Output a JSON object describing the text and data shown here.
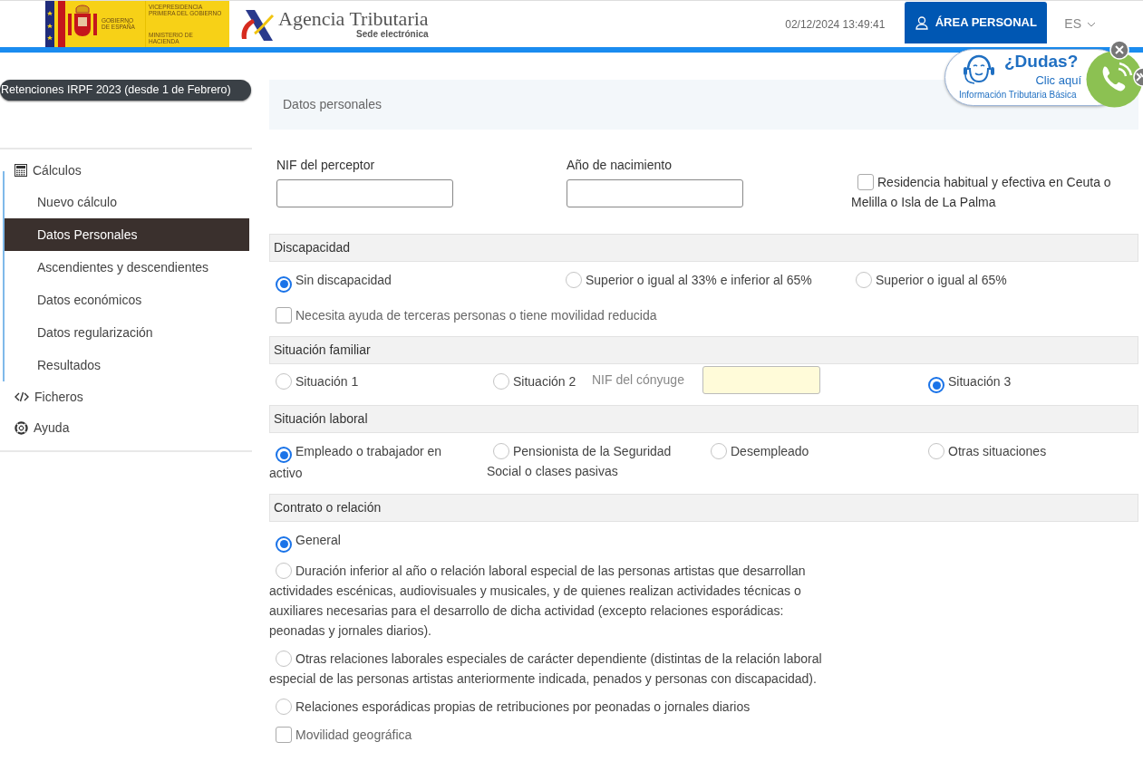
{
  "header": {
    "gov_top": "VICEPRESIDENCIA PRIMERA DEL GOBIERNO",
    "gov_left": "GOBIERNO DE ESPAÑA",
    "gov_bottom": "MINISTERIO DE HACIENDA",
    "agency": "Agencia Tributaria",
    "agency_sub": "Sede electrónica",
    "datetime": "02/12/2024 13:49:41",
    "area_button": "ÁREA PERSONAL",
    "language": "ES"
  },
  "help_widget": {
    "title": "¿Dudas?",
    "link": "Clic aquí",
    "subtitle": "Información Tributaria Básica"
  },
  "sidebar": {
    "title": "Retenciones IRPF 2023 (desde 1 de Febrero)",
    "items": [
      {
        "label": "Cálculos",
        "children": [
          {
            "label": "Nuevo cálculo",
            "selected": false
          },
          {
            "label": "Datos Personales",
            "selected": true
          },
          {
            "label": "Ascendientes y descendientes",
            "selected": false
          },
          {
            "label": "Datos económicos",
            "selected": false
          },
          {
            "label": "Datos regularización",
            "selected": false
          },
          {
            "label": "Resultados",
            "selected": false
          }
        ]
      },
      {
        "label": "Ficheros"
      },
      {
        "label": "Ayuda"
      }
    ]
  },
  "panel_title": "Datos personales",
  "top_fields": [
    {
      "label": "NIF del perceptor"
    },
    {
      "label": "Año de nacimiento"
    }
  ],
  "residence_checkbox": {
    "label": "Residencia habitual y efectiva en Ceuta o Melilla o Isla de La Palma",
    "checked": false
  },
  "sections": [
    {
      "title": "Discapacidad",
      "rows": [
        [
          {
            "kind": "radio",
            "label": "Sin discapacidad",
            "selected": true
          },
          {
            "kind": "radio",
            "label": "Superior o igual al 33% e inferior al 65%",
            "selected": false
          },
          {
            "kind": "radio",
            "label": "Superior o igual al 65%",
            "selected": false
          }
        ],
        [
          {
            "kind": "checkbox",
            "label": "Necesita ayuda de terceras personas o tiene movilidad reducida",
            "checked": false
          }
        ]
      ]
    },
    {
      "title": "Situación familiar",
      "rows": [
        [
          {
            "kind": "radio",
            "label": "Situación 1",
            "selected": false
          },
          {
            "kind": "radio",
            "label": "Situación 2",
            "selected": false
          },
          {
            "kind": "field",
            "label": "NIF del cónyuge"
          },
          {
            "kind": "radio",
            "label": "Situación 3",
            "selected": true
          }
        ]
      ]
    },
    {
      "title": "Situación laboral",
      "rows": [
        [
          {
            "kind": "radio",
            "label": "Empleado o trabajador en activo",
            "selected": true
          },
          {
            "kind": "radio",
            "label": "Pensionista de la Seguridad Social o clases pasivas",
            "selected": false
          },
          {
            "kind": "radio",
            "label": "Desempleado",
            "selected": false
          },
          {
            "kind": "radio",
            "label": "Otras situaciones",
            "selected": false
          }
        ]
      ]
    },
    {
      "title": "Contrato o relación",
      "rows": [
        [
          {
            "kind": "radio",
            "label": "General",
            "selected": true
          }
        ],
        [
          {
            "kind": "radio",
            "label": "Duración inferior al año o relación laboral especial de las personas artistas que desarrollan actividades escénicas, audiovisuales y musicales, y de quienes realizan actividades técnicas o auxiliares necesarias para el desarrollo de dicha actividad (excepto relaciones esporádicas: peonadas y jornales diarios).",
            "selected": false
          }
        ],
        [
          {
            "kind": "radio",
            "label": "Otras relaciones laborales especiales de carácter dependiente (distintas de la relación laboral especial de las personas artistas anteriormente indicada, penados y personas con discapacidad).",
            "selected": false
          }
        ],
        [
          {
            "kind": "radio",
            "label": "Relaciones esporádicas propias de retribuciones por peonadas o jornales diarios",
            "selected": false
          }
        ],
        [
          {
            "kind": "checkbox",
            "label": "Movilidad geográfica",
            "checked": false
          }
        ]
      ]
    }
  ]
}
